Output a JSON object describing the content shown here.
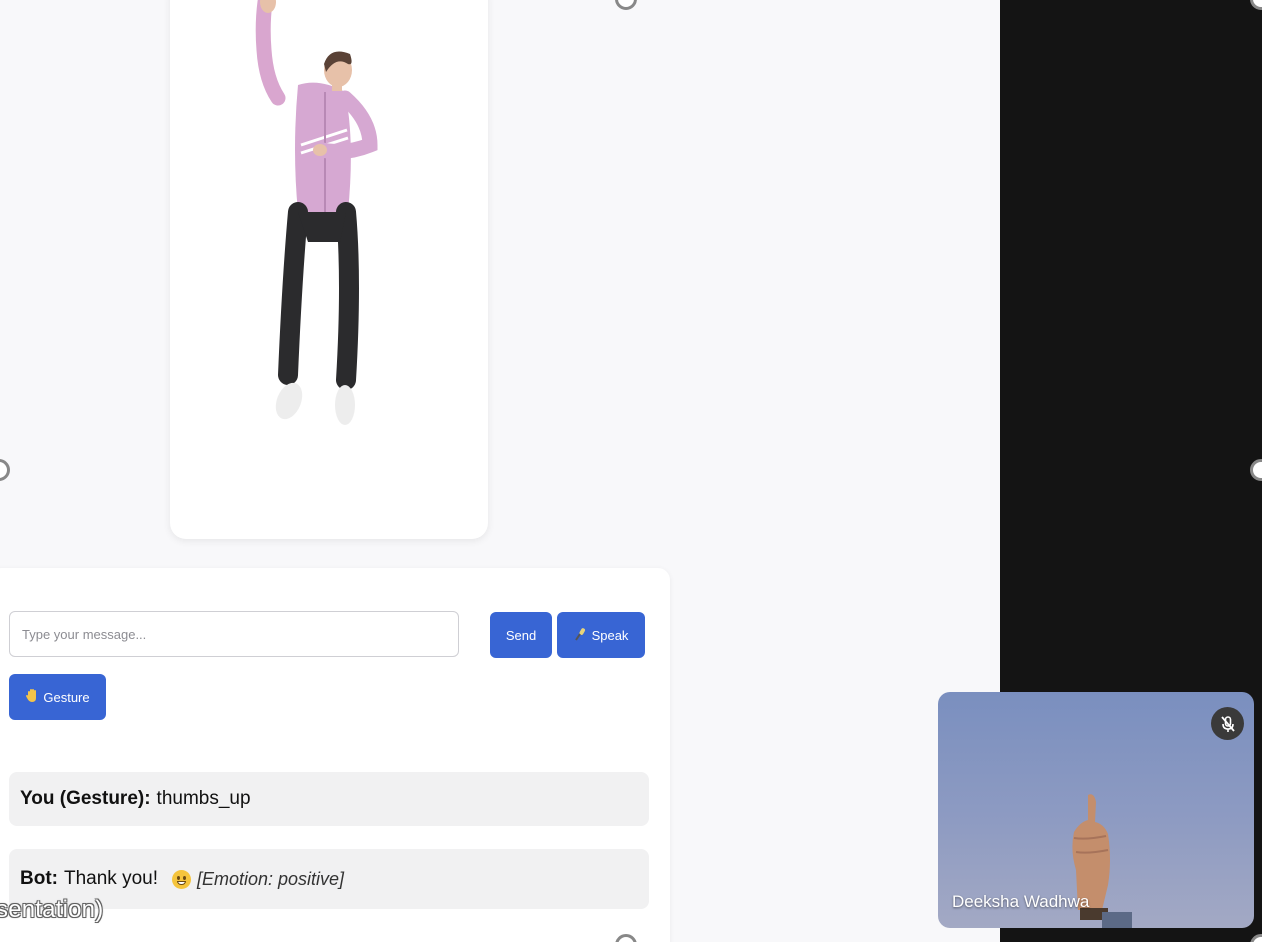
{
  "chat": {
    "input_placeholder": "Type your message...",
    "send_label": "Send",
    "speak_label": "Speak",
    "gesture_label": "Gesture",
    "messages": [
      {
        "sender": "You (Gesture):",
        "text": "thumbs_up"
      },
      {
        "sender": "Bot:",
        "text": "Thank you!",
        "emotion": "[Emotion: positive]"
      }
    ]
  },
  "caption": "sentation)",
  "video": {
    "participant_name": "Deeksha Wadhwa"
  },
  "icons": [
    "microphone-icon",
    "hand-icon",
    "smile-emoji-icon",
    "mic-muted-icon"
  ],
  "colors": {
    "accent": "#3865d4",
    "dark_panel": "#141414",
    "page_bg": "#f8f8fa"
  }
}
